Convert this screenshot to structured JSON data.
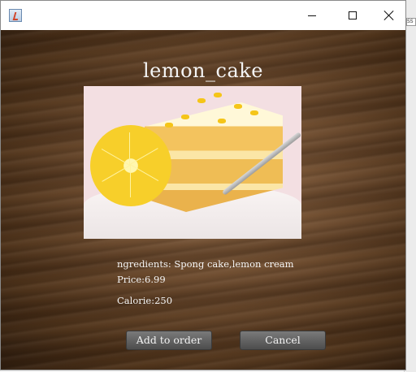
{
  "window": {
    "title": "",
    "controls": {
      "minimize": "minimize",
      "maximize": "maximize",
      "close": "close"
    }
  },
  "product": {
    "name": "lemon_cake",
    "ingredients_text": "ngredients: Spong cake,lemon cream",
    "price_text": "Price:6.99",
    "calorie_text": "Calorie:250"
  },
  "actions": {
    "add_label": "Add to order",
    "cancel_label": "Cancel"
  },
  "background_app": {
    "tab_text": "SS"
  },
  "colors": {
    "title_text": "#f4f4f4",
    "button_bg": "#5e5e5e",
    "wood_base": "#6b4a2e"
  },
  "icons": {
    "app": "java-cup-icon",
    "minimize": "minimize-icon",
    "maximize": "maximize-icon",
    "close": "close-icon"
  }
}
